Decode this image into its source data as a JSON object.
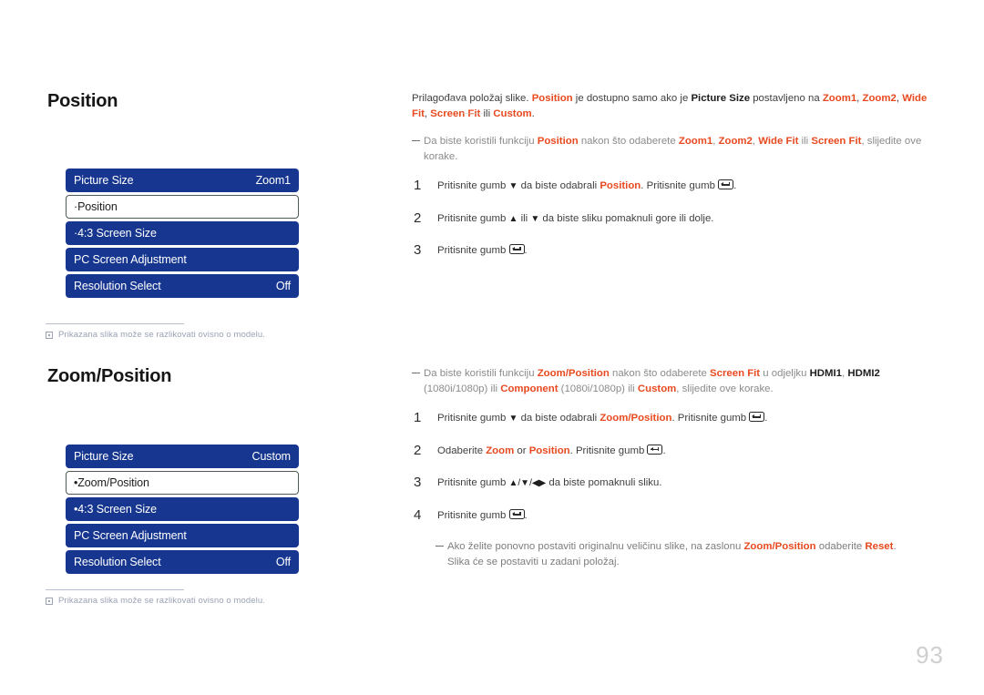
{
  "page": {
    "number": "93",
    "language": "hr"
  },
  "sections": [
    {
      "id": "position",
      "heading": "Position",
      "osd_menu": {
        "rows": [
          {
            "label": "Picture Size",
            "value": "Zoom1",
            "selected": false
          },
          {
            "label": "·Position",
            "value": "",
            "selected": true
          },
          {
            "label": "·4:3 Screen Size",
            "value": "",
            "selected": false
          },
          {
            "label": "PC Screen Adjustment",
            "value": "",
            "selected": false
          },
          {
            "label": "Resolution Select",
            "value": "Off",
            "selected": false
          }
        ]
      },
      "caption": "Prikazana slika može se razlikovati ovisno o modelu.",
      "intro": {
        "t1": "Prilagođava položaj slike. ",
        "b1": "Position",
        "t2": " je dostupno samo ako je ",
        "b2": "Picture Size",
        "t3": " postavljeno na ",
        "b3": "Zoom1",
        "t4": ", ",
        "b4": "Zoom2",
        "t5": ", ",
        "b5": "Wide Fit",
        "t6": ", ",
        "b6": "Screen Fit",
        "t7": " ili ",
        "b7": "Custom",
        "t8": "."
      },
      "hint": {
        "t1": "Da biste koristili funkciju ",
        "b1": "Position",
        "t2": " nakon što odaberete ",
        "b2": "Zoom1",
        "t3": ", ",
        "b3": "Zoom2",
        "t4": ", ",
        "b4": "Wide Fit",
        "t5": " ili ",
        "b5": "Screen Fit",
        "t6": ", slijedite ove korake."
      },
      "steps": [
        {
          "num": "1",
          "t1": "Pritisnite gumb ",
          "arrow": "▼",
          "t2": " da biste odabrali ",
          "b1": "Position",
          "t3": ". Pritisnite gumb ",
          "key": "enter-key",
          "t4": "."
        },
        {
          "num": "2",
          "t1": "Pritisnite gumb ",
          "arrow": "▲",
          "t2": " ili ",
          "arrow2": "▼",
          "t3": " da biste sliku pomaknuli gore ili dolje.",
          "t4": ""
        },
        {
          "num": "3",
          "t1": "Pritisnite gumb ",
          "key": "enter-key",
          "t4": "."
        }
      ]
    },
    {
      "id": "zoom-position",
      "heading": "Zoom/Position",
      "osd_menu": {
        "rows": [
          {
            "label": "Picture Size",
            "value": "Custom",
            "selected": false
          },
          {
            "label": "•Zoom/Position",
            "value": "",
            "selected": true
          },
          {
            "label": "•4:3 Screen Size",
            "value": "",
            "selected": false
          },
          {
            "label": "PC Screen Adjustment",
            "value": "",
            "selected": false
          },
          {
            "label": "Resolution Select",
            "value": "Off",
            "selected": false
          }
        ]
      },
      "caption": "Prikazana slika može se razlikovati ovisno o modelu.",
      "hint": {
        "t1": "Da biste koristili funkciju ",
        "b1": "Zoom/Position",
        "t2": " nakon što odaberete ",
        "b2": "Screen Fit",
        "t3": " u odjeljku ",
        "b3": "HDMI1",
        "t4": ", ",
        "b4": "HDMI2",
        "t5": " (1080i/1080p) ili ",
        "b5": "Component",
        "t6": " (1080i/1080p) ili ",
        "b6": "Custom",
        "t7": ", slijedite ove korake."
      },
      "steps": [
        {
          "num": "1",
          "t1": "Pritisnite gumb ",
          "arrow": "▼",
          "t2": " da biste odabrali ",
          "b1": "Zoom/Position",
          "t3": ". Pritisnite gumb ",
          "key": "enter-key",
          "t4": "."
        },
        {
          "num": "2",
          "t1": "Odaberite ",
          "b1": "Zoom",
          "t2": " or ",
          "b2": "Position",
          "t3": ". Pritisnite gumb ",
          "key": "enter-key",
          "t4": "."
        },
        {
          "num": "3",
          "t1": "Pritisnite gumb ",
          "arrow": "▲/▼/◀▶",
          "t3": " da biste pomaknuli sliku.",
          "t4": ""
        },
        {
          "num": "4",
          "t1": "Pritisnite gumb ",
          "key": "enter-key",
          "t4": "."
        }
      ],
      "footnote": {
        "t1": "Ako želite ponovno postaviti originalnu veličinu slike, na zaslonu ",
        "b1": "Zoom/Position",
        "t2": " odaberite ",
        "b2": "Reset",
        "t3": ".",
        "line2": "Slika će se postaviti u zadani položaj."
      }
    }
  ],
  "colors": {
    "osd_blue": "#16368f",
    "accent_orange": "#e8491f",
    "body_text": "#3f3f3f",
    "muted_text": "#8b8b8b",
    "caption_text": "#9aa2b4",
    "page_number": "#cfcfcf"
  }
}
